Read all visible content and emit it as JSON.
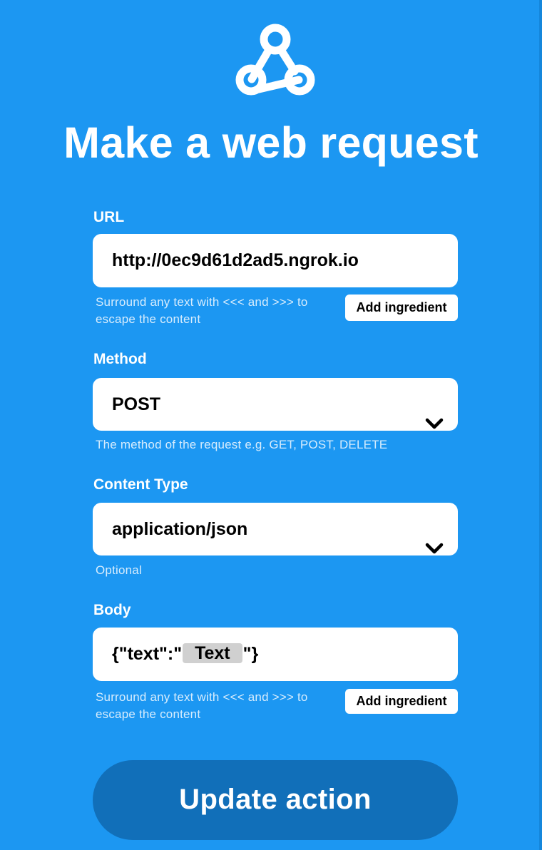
{
  "header": {
    "logo_icon": "webhooks-icon",
    "title": "Make a web request"
  },
  "url_field": {
    "label": "URL",
    "value": "http://0ec9d61d2ad5.ngrok.io",
    "hint_line1": "Surround any text with <<< and >>> to",
    "hint_line2": "escape the content",
    "add_ingredient_label": "Add ingredient"
  },
  "method_field": {
    "label": "Method",
    "selected": "POST",
    "hint": "The method of the request e.g. GET, POST, DELETE",
    "icon": "chevron-down-icon"
  },
  "content_type_field": {
    "label": "Content Type",
    "selected": "application/json",
    "hint": "Optional",
    "icon": "chevron-down-icon"
  },
  "body_field": {
    "label": "Body",
    "value_prefix": "{\"text\":\"",
    "ingredient": "Text",
    "value_suffix": "\"}",
    "hint_line1": "Surround any text with <<< and >>> to",
    "hint_line2": "escape the content",
    "add_ingredient_label": "Add ingredient"
  },
  "submit": {
    "label": "Update action"
  },
  "colors": {
    "background": "#1c97f2",
    "submit_button": "#116fb9",
    "ingredient_pill": "#d0d0d0"
  }
}
